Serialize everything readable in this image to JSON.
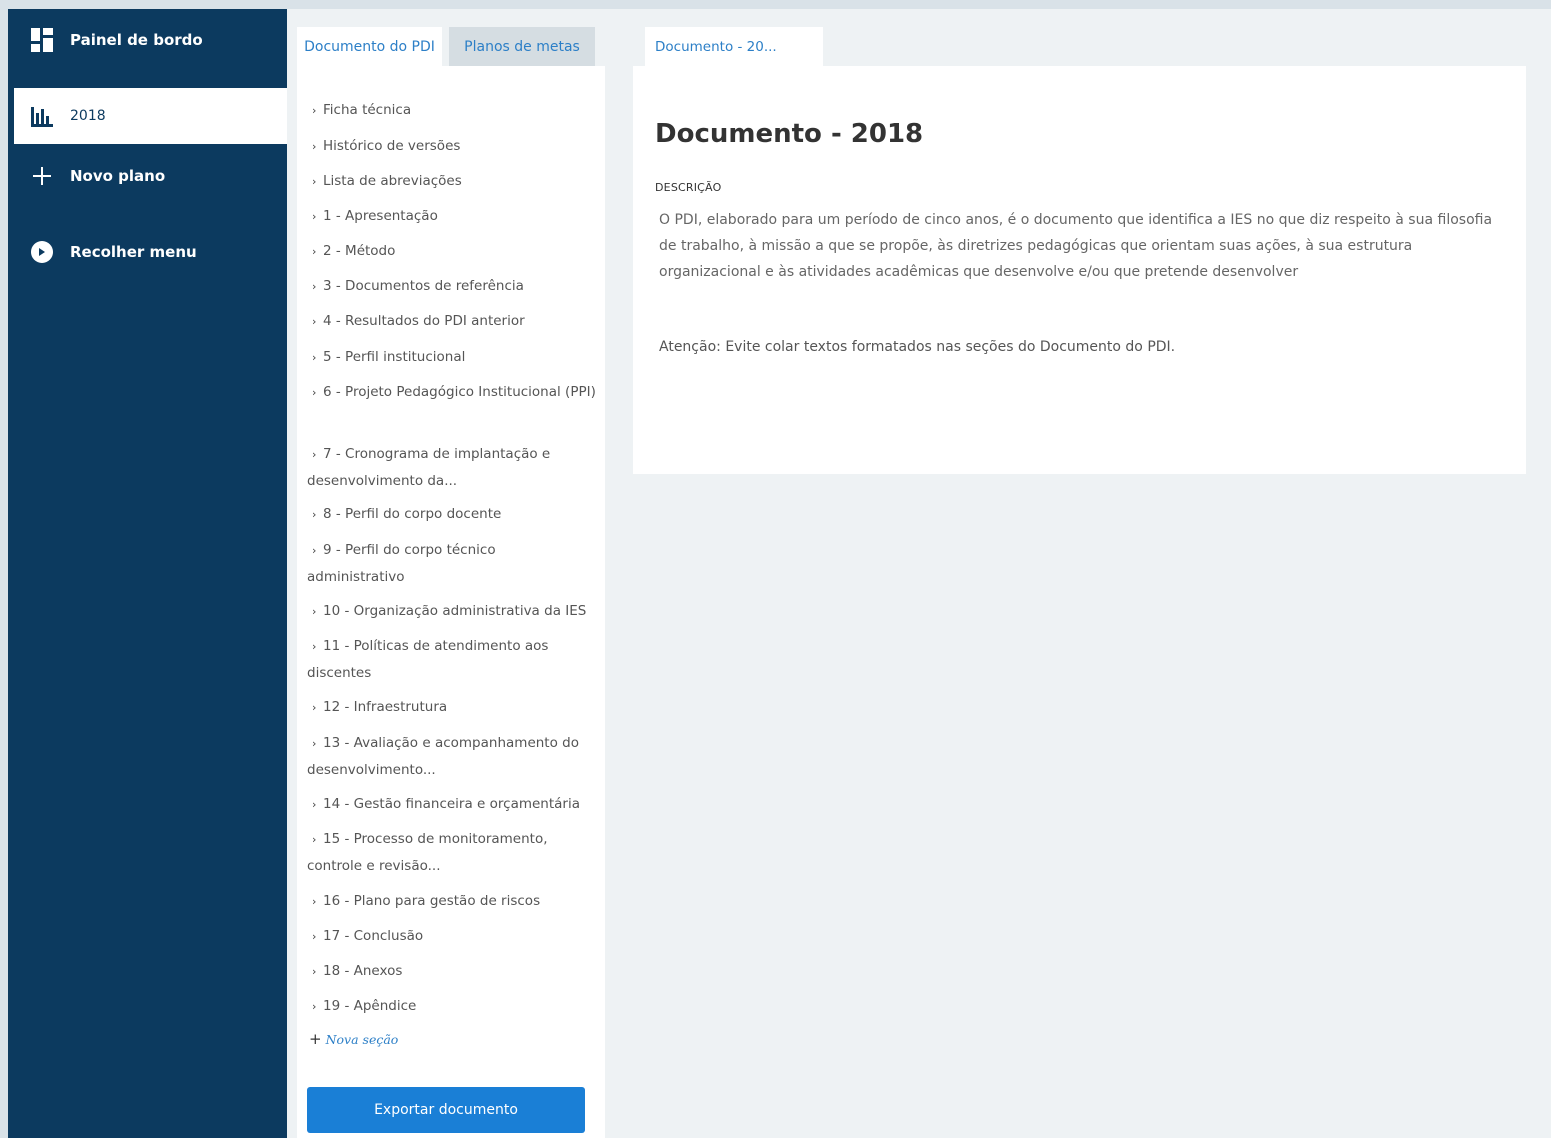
{
  "sidebar": {
    "items": [
      {
        "label": "Painel de bordo",
        "icon": "dashboard-icon"
      },
      {
        "label": "2018",
        "icon": "bar-chart-icon",
        "active": true
      },
      {
        "label": "Novo plano",
        "icon": "plus-icon"
      },
      {
        "label": "Recolher menu",
        "icon": "collapse-icon"
      }
    ]
  },
  "tabs": {
    "document": "Documento do PDI",
    "goals": "Planos de metas"
  },
  "toc": {
    "items": [
      "Ficha técnica",
      "Histórico de versões",
      "Lista de abreviações",
      "1 - Apresentação",
      "2 - Método",
      "3 - Documentos de referência",
      "4 - Resultados do PDI anterior",
      "5 - Perfil institucional",
      "6 - Projeto Pedagógico Institucional (PPI)",
      "7 - Cronograma de implantação e desenvolvimento da...",
      "8 - Perfil do corpo docente",
      "9 - Perfil do corpo técnico administrativo",
      "10 - Organização administrativa da IES",
      "11 - Políticas de atendimento aos discentes",
      "12 - Infraestrutura",
      "13 - Avaliação e acompanhamento do desenvolvimento...",
      "14 - Gestão financeira e orçamentária",
      "15 - Processo de monitoramento, controle e revisão...",
      "16 - Plano para gestão de riscos",
      "17 - Conclusão",
      "18 - Anexos",
      "19 - Apêndice"
    ],
    "new_section": "Nova seção",
    "export_button": "Exportar documento"
  },
  "content": {
    "tab_label": "Documento - 20...",
    "title": "Documento - 2018",
    "description_label": "DESCRIÇÃO",
    "description": "O PDI, elaborado para um período de cinco anos, é o documento que identifica a IES no que diz respeito à sua filosofia de trabalho, à missão a que se propõe, às diretrizes pedagógicas que orientam suas ações, à sua estrutura organizacional e às atividades acadêmicas que desenvolve e/ou que pretende desenvolver",
    "warning": "Atenção: Evite colar textos formatados nas seções do Documento do PDI."
  },
  "colors": {
    "sidebar_bg": "#0c3a5f",
    "accent": "#1a7fd6",
    "link": "#2c7fc7",
    "page_bg": "#eef2f4"
  }
}
